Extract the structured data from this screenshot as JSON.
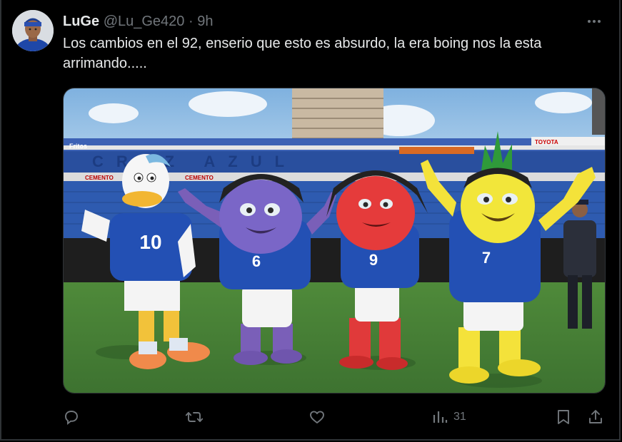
{
  "tweet": {
    "display_name": "LuGe",
    "handle": "@Lu_Ge420",
    "separator": "·",
    "time": "9h",
    "text": "Los cambios en el 92, enserio que esto es absurdo, la era boing nos la esta arrimando.....",
    "more_icon": "more-dots-icon"
  },
  "media": {
    "stadium_signs": {
      "brand_left": "Fritos",
      "brand_right": "TOYOTA",
      "ad_cemento_1": "CEMENTO",
      "ad_cemento_2": "CEMENTO",
      "seat_letters": "CRUZ AZUL"
    },
    "mascots": [
      {
        "number": "10",
        "character": "duck"
      },
      {
        "number": "6",
        "character": "grape"
      },
      {
        "number": "9",
        "character": "strawberry"
      },
      {
        "number": "7",
        "character": "pineapple"
      }
    ]
  },
  "actions": {
    "reply_icon": "reply-icon",
    "retweet_icon": "retweet-icon",
    "like_icon": "like-icon",
    "views_icon": "views-icon",
    "views_count": "31",
    "bookmark_icon": "bookmark-icon",
    "share_icon": "share-icon"
  },
  "colors": {
    "background": "#000000",
    "text": "#e7e9ea",
    "muted": "#71767b",
    "jersey_blue": "#2350b4"
  }
}
